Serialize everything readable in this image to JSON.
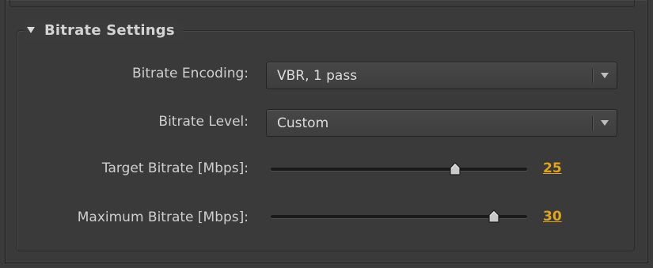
{
  "section": {
    "title": "Bitrate Settings",
    "expanded": true
  },
  "fields": {
    "encoding": {
      "label": "Bitrate Encoding:",
      "value": "VBR, 1 pass"
    },
    "level": {
      "label": "Bitrate Level:",
      "value": "Custom"
    },
    "target": {
      "label": "Target Bitrate [Mbps]:",
      "value": "25",
      "slider_fraction": 0.72
    },
    "maximum": {
      "label": "Maximum Bitrate [Mbps]:",
      "value": "30",
      "slider_fraction": 0.87
    }
  },
  "colors": {
    "accent": "#e0a41b",
    "panel_bg": "#3b3b3b",
    "text": "#cfcfcf"
  }
}
